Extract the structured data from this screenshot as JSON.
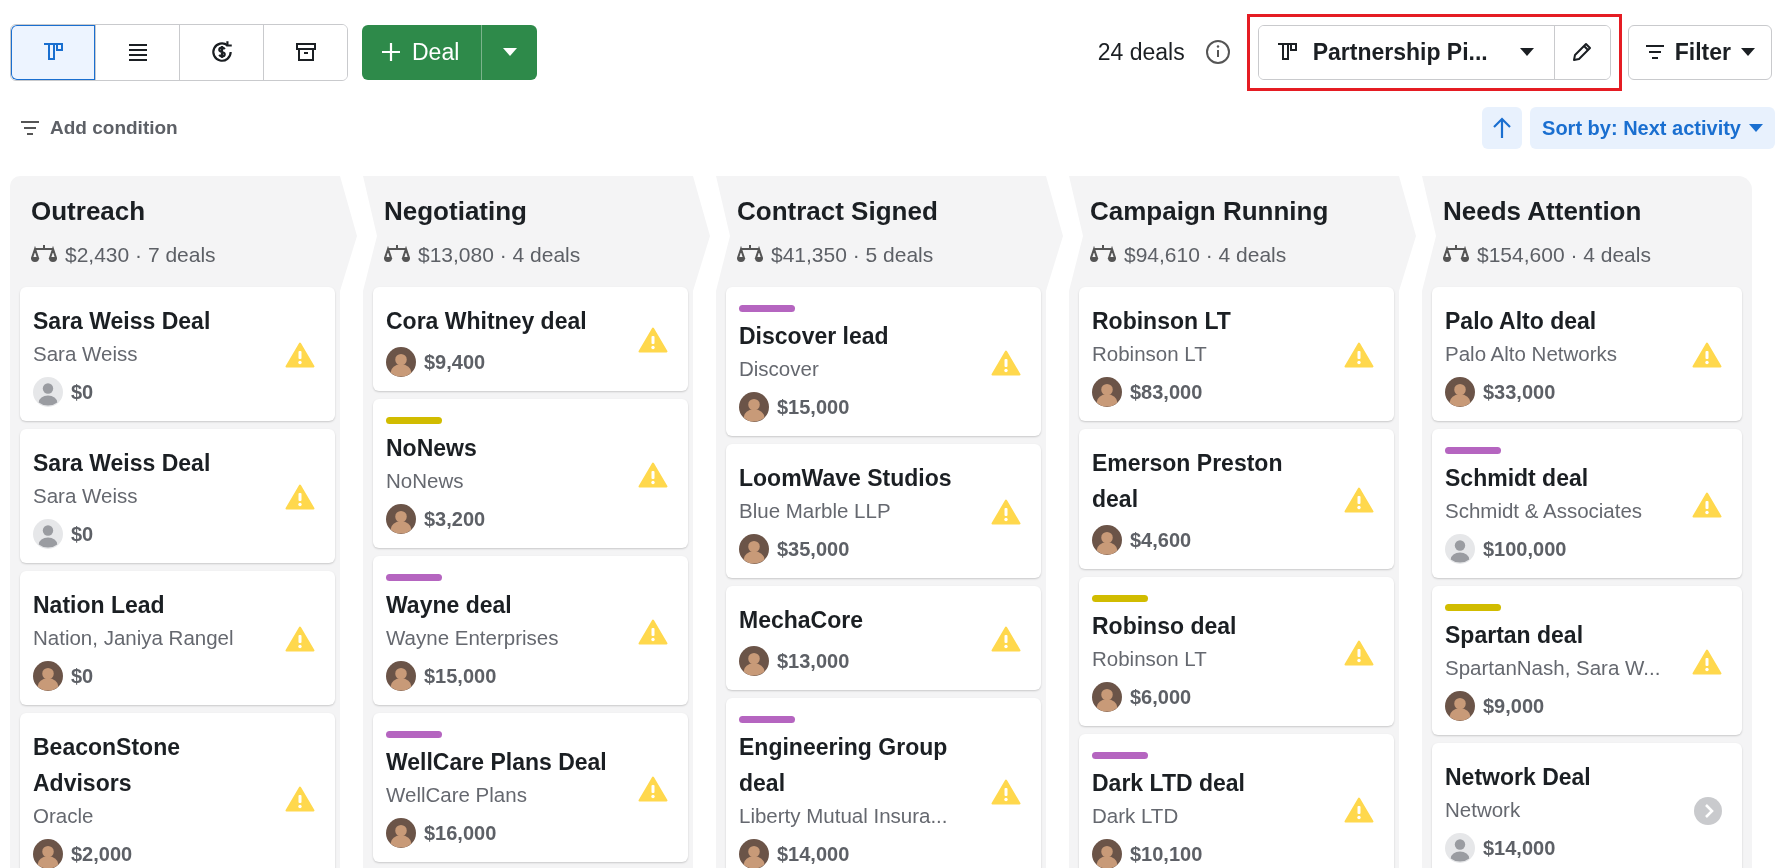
{
  "toolbar": {
    "view_tabs": [
      {
        "kind": "board",
        "selected": true
      },
      {
        "kind": "list",
        "selected": false
      },
      {
        "kind": "forecast",
        "selected": false
      },
      {
        "kind": "archive",
        "selected": false
      }
    ],
    "add_button": {
      "label": "Deal"
    },
    "deal_count": "24 deals",
    "pipeline": {
      "label": "Partnership Pi...",
      "highlighted": true
    },
    "filter": {
      "label": "Filter"
    }
  },
  "conditions": {
    "add_label": "Add condition",
    "sort": {
      "label": "Sort by: Next activity"
    }
  },
  "stages": [
    {
      "title": "Outreach",
      "summary": "$2,430 · 7 deals",
      "deals": [
        {
          "title": "Sara Weiss Deal",
          "subtitle": "Sara Weiss",
          "avatar": {
            "kind": "placeholder"
          },
          "amount": "$0",
          "status": {
            "kind": "warning"
          }
        },
        {
          "title": "Sara Weiss Deal",
          "subtitle": "Sara Weiss",
          "avatar": {
            "kind": "placeholder"
          },
          "amount": "$0",
          "status": {
            "kind": "warning"
          }
        },
        {
          "title": "Nation Lead",
          "subtitle": "Nation, Janiya Rangel",
          "avatar": {
            "kind": "person"
          },
          "amount": "$0",
          "status": {
            "kind": "warning"
          }
        },
        {
          "title": "BeaconStone Advisors",
          "subtitle": "Oracle",
          "avatar": {
            "kind": "person"
          },
          "amount": "$2,000",
          "status": {
            "kind": "warning"
          }
        }
      ]
    },
    {
      "title": "Negotiating",
      "summary": "$13,080 · 4 deals",
      "deals": [
        {
          "title": "Cora Whitney deal",
          "avatar": {
            "kind": "person"
          },
          "amount": "$9,400",
          "status": {
            "kind": "warning"
          }
        },
        {
          "title": "NoNews",
          "subtitle": "NoNews",
          "avatar": {
            "kind": "person"
          },
          "amount": "$3,200",
          "status": {
            "kind": "warning"
          },
          "color": "#d1bc00"
        },
        {
          "title": "Wayne deal",
          "subtitle": "Wayne Enterprises",
          "avatar": {
            "kind": "person"
          },
          "amount": "$15,000",
          "status": {
            "kind": "warning"
          },
          "color": "#b565c0"
        },
        {
          "title": "WellCare Plans Deal",
          "subtitle": "WellCare Plans",
          "avatar": {
            "kind": "person"
          },
          "amount": "$16,000",
          "status": {
            "kind": "warning"
          },
          "color": "#b565c0"
        }
      ]
    },
    {
      "title": "Contract Signed",
      "summary": "$41,350 · 5 deals",
      "deals": [
        {
          "title": "Discover lead",
          "subtitle": "Discover",
          "avatar": {
            "kind": "person"
          },
          "amount": "$15,000",
          "status": {
            "kind": "warning"
          },
          "color": "#b565c0"
        },
        {
          "title": "LoomWave Studios",
          "subtitle": "Blue Marble LLP",
          "avatar": {
            "kind": "person"
          },
          "amount": "$35,000",
          "status": {
            "kind": "warning"
          }
        },
        {
          "title": "MechaCore",
          "avatar": {
            "kind": "person"
          },
          "amount": "$13,000",
          "status": {
            "kind": "warning"
          }
        },
        {
          "title": "Engineering Group deal",
          "subtitle": "Liberty Mutual Insura...",
          "avatar": {
            "kind": "person"
          },
          "amount": "$14,000",
          "status": {
            "kind": "warning"
          },
          "color": "#b565c0"
        }
      ]
    },
    {
      "title": "Campaign Running",
      "summary": "$94,610 · 4 deals",
      "deals": [
        {
          "title": "Robinson LT",
          "subtitle": "Robinson LT",
          "avatar": {
            "kind": "person"
          },
          "amount": "$83,000",
          "status": {
            "kind": "warning"
          }
        },
        {
          "title": "Emerson Preston deal",
          "avatar": {
            "kind": "person"
          },
          "amount": "$4,600",
          "status": {
            "kind": "warning"
          }
        },
        {
          "title": "Robinso deal",
          "subtitle": "Robinson LT",
          "avatar": {
            "kind": "person"
          },
          "amount": "$6,000",
          "status": {
            "kind": "warning"
          },
          "color": "#d1bc00"
        },
        {
          "title": "Dark LTD deal",
          "subtitle": "Dark LTD",
          "avatar": {
            "kind": "person"
          },
          "amount": "$10,100",
          "status": {
            "kind": "warning"
          },
          "color": "#b565c0"
        }
      ]
    },
    {
      "title": "Needs Attention",
      "summary": "$154,600 · 4 deals",
      "deals": [
        {
          "title": "Palo Alto deal",
          "subtitle": "Palo Alto Networks",
          "avatar": {
            "kind": "person"
          },
          "amount": "$33,000",
          "status": {
            "kind": "warning"
          }
        },
        {
          "title": "Schmidt deal",
          "subtitle": "Schmidt & Associates",
          "avatar": {
            "kind": "placeholder"
          },
          "amount": "$100,000",
          "status": {
            "kind": "warning"
          },
          "color": "#b565c0"
        },
        {
          "title": "Spartan deal",
          "subtitle": "SpartanNash, Sara W...",
          "avatar": {
            "kind": "person"
          },
          "amount": "$9,000",
          "status": {
            "kind": "warning"
          },
          "color": "#d1bc00"
        },
        {
          "title": "Network Deal",
          "subtitle": "Network",
          "avatar": {
            "kind": "placeholder"
          },
          "amount": "$14,000",
          "status": {
            "kind": "next"
          }
        }
      ]
    }
  ]
}
